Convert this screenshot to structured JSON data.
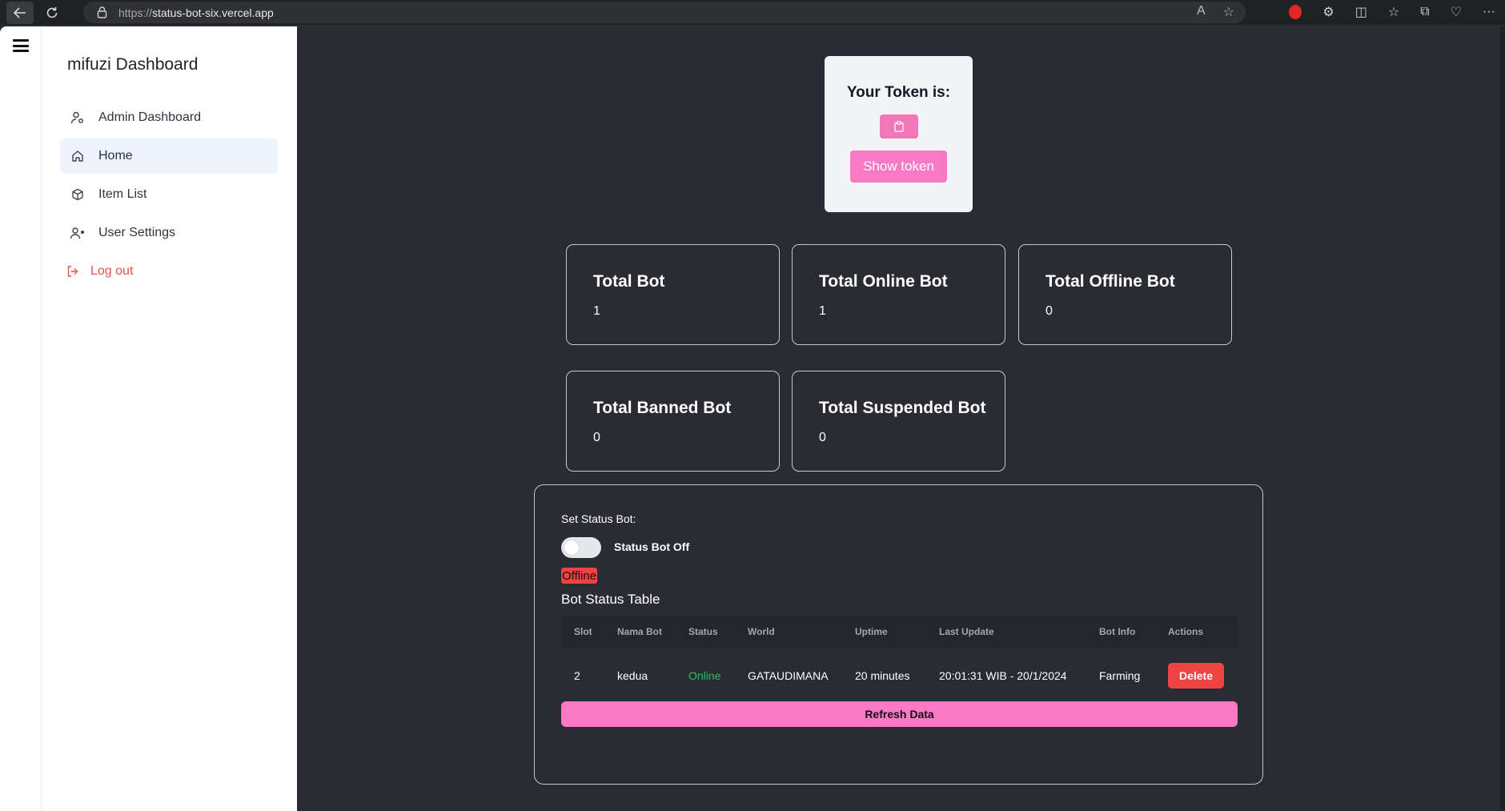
{
  "browser": {
    "url_protocol": "https://",
    "url_host": "status-bot-six.vercel.app"
  },
  "sidebar": {
    "brand": "mifuzi Dashboard",
    "items": [
      {
        "label": "Admin Dashboard",
        "icon": "user-cog-icon"
      },
      {
        "label": "Home",
        "icon": "home-icon"
      },
      {
        "label": "Item List",
        "icon": "box-icon"
      },
      {
        "label": "User Settings",
        "icon": "user-settings-icon"
      },
      {
        "label": "Log out",
        "icon": "logout-icon"
      }
    ]
  },
  "token": {
    "title": "Your Token is:",
    "copy_icon": "clipboard-icon",
    "show_label": "Show token"
  },
  "stats": [
    {
      "label": "Total Bot",
      "value": "1"
    },
    {
      "label": "Total Online Bot",
      "value": "1"
    },
    {
      "label": "Total Offline Bot",
      "value": "0"
    },
    {
      "label": "Total Banned Bot",
      "value": "0"
    },
    {
      "label": "Total Suspended Bot",
      "value": "0"
    }
  ],
  "bot_panel": {
    "set_status_label": "Set Status Bot:",
    "toggle_label": "Status Bot Off",
    "toggle_on": false,
    "offline_badge": "Offline",
    "table_title": "Bot Status Table",
    "columns": [
      "Slot",
      "Nama Bot",
      "Status",
      "World",
      "Uptime",
      "Last Update",
      "Bot Info",
      "Actions"
    ],
    "rows": [
      {
        "slot": "2",
        "name": "kedua",
        "status": "Online",
        "world": "GATAUDIMANA",
        "uptime": "20 minutes",
        "last_update": "20:01:31 WIB - 20/1/2024",
        "bot_info": "Farming",
        "action": "Delete"
      }
    ],
    "refresh_label": "Refresh Data"
  },
  "colors": {
    "page_bg": "#2b2c33",
    "accent_pink": "#f979c5",
    "danger": "#ef4444",
    "online": "#22c55e"
  }
}
